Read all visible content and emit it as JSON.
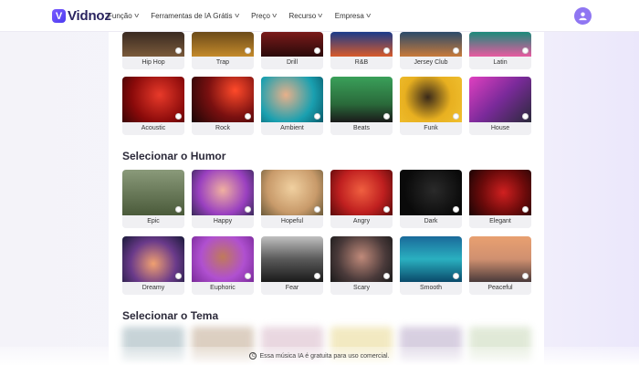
{
  "brand": {
    "name": "Vidnoz"
  },
  "nav": [
    {
      "label": "Função"
    },
    {
      "label": "Ferramentas de IA Grátis"
    },
    {
      "label": "Preço"
    },
    {
      "label": "Recurso"
    },
    {
      "label": "Empresa"
    }
  ],
  "genres_top": [
    {
      "label": "Hip Hop",
      "bg": "linear-gradient(180deg,#3a2a22 0%,#7a5a3a 100%)"
    },
    {
      "label": "Trap",
      "bg": "linear-gradient(180deg,#6b4a1a 0%,#c48a2a 100%)"
    },
    {
      "label": "Drill",
      "bg": "linear-gradient(180deg,#7a1a1a 0%,#2a0a0a 100%)"
    },
    {
      "label": "R&B",
      "bg": "linear-gradient(180deg,#1a3a8a 0%,#d85a2a 100%)"
    },
    {
      "label": "Jersey Club",
      "bg": "linear-gradient(180deg,#2a4a6a 0%,#c87a3a 100%)"
    },
    {
      "label": "Latin",
      "bg": "linear-gradient(180deg,#1a8a7a 0%,#e85aa0 100%)"
    }
  ],
  "genres": [
    {
      "label": "Acoustic",
      "bg": "radial-gradient(circle at 60% 40%,#e83a2a 0%,#8a0a0a 60%,#3a0505 100%)"
    },
    {
      "label": "Rock",
      "bg": "radial-gradient(circle at 70% 30%,#ff4a2a 0%,#7a1010 50%,#1a0505 100%)"
    },
    {
      "label": "Ambient",
      "bg": "radial-gradient(circle at 40% 40%,#e8b08a 0%,#1aa0b0 60%,#0a5a6a 100%)"
    },
    {
      "label": "Beats",
      "bg": "linear-gradient(180deg,#3aa05a 0%,#2a6a3a 60%,#1a1a1a 100%)"
    },
    {
      "label": "Funk",
      "bg": "radial-gradient(circle at 45% 45%,#3a2a1a 0%,#e8b020 55%,#f0c030 100%)"
    },
    {
      "label": "House",
      "bg": "linear-gradient(135deg,#e040c0 0%,#7a2a9a 50%,#2a2a3a 100%)"
    }
  ],
  "mood_section": {
    "title": "Selecionar o Humor"
  },
  "moods_row1": [
    {
      "label": "Epic",
      "bg": "linear-gradient(180deg,#8a9a7a 0%,#4a5a3a 100%)"
    },
    {
      "label": "Happy",
      "bg": "radial-gradient(circle at 50% 45%,#f0b0a0 0%,#9a40c0 60%,#3a2a5a 100%)"
    },
    {
      "label": "Hopeful",
      "bg": "radial-gradient(circle at 50% 40%,#f0d0a0 0%,#c89a6a 60%,#6a5a3a 100%)"
    },
    {
      "label": "Angry",
      "bg": "radial-gradient(circle at 50% 45%,#f06040 0%,#c02020 55%,#5a0a0a 100%)"
    },
    {
      "label": "Dark",
      "bg": "radial-gradient(circle at 55% 45%,#2a2a2a 0%,#0a0a0a 70%)"
    },
    {
      "label": "Elegant",
      "bg": "radial-gradient(circle at 55% 50%,#d02020 0%,#6a0a0a 55%,#1a0505 100%)"
    }
  ],
  "moods_row2": [
    {
      "label": "Dreamy",
      "bg": "radial-gradient(circle at 50% 60%,#f0a070 0%,#6a3a8a 55%,#1a1a3a 100%)"
    },
    {
      "label": "Euphoric",
      "bg": "radial-gradient(circle at 50% 45%,#c07a5a 0%,#b050d0 55%,#7a2a9a 100%)"
    },
    {
      "label": "Fear",
      "bg": "linear-gradient(180deg,#c0c0c0 0%,#5a5a5a 50%,#1a1a1a 100%)"
    },
    {
      "label": "Scary",
      "bg": "radial-gradient(circle at 50% 45%,#c08a7a 0%,#4a3a3a 60%,#1a1a1a 100%)"
    },
    {
      "label": "Smooth",
      "bg": "linear-gradient(180deg,#1a6a9a 0%,#2ab0c0 50%,#0a4a6a 100%)"
    },
    {
      "label": "Peaceful",
      "bg": "linear-gradient(180deg,#e8a070 0%,#d09070 50%,#4a3a3a 100%)"
    }
  ],
  "theme_section": {
    "title": "Selecionar o Tema"
  },
  "themes_blurred": [
    {
      "bg": "#9ab0b8"
    },
    {
      "bg": "#c0a890"
    },
    {
      "bg": "#d8b8c8"
    },
    {
      "bg": "#e8d890"
    },
    {
      "bg": "#b8a8c8"
    },
    {
      "bg": "#c8d8b8"
    }
  ],
  "footer": {
    "note": "Essa música IA é gratuita para uso comercial."
  }
}
